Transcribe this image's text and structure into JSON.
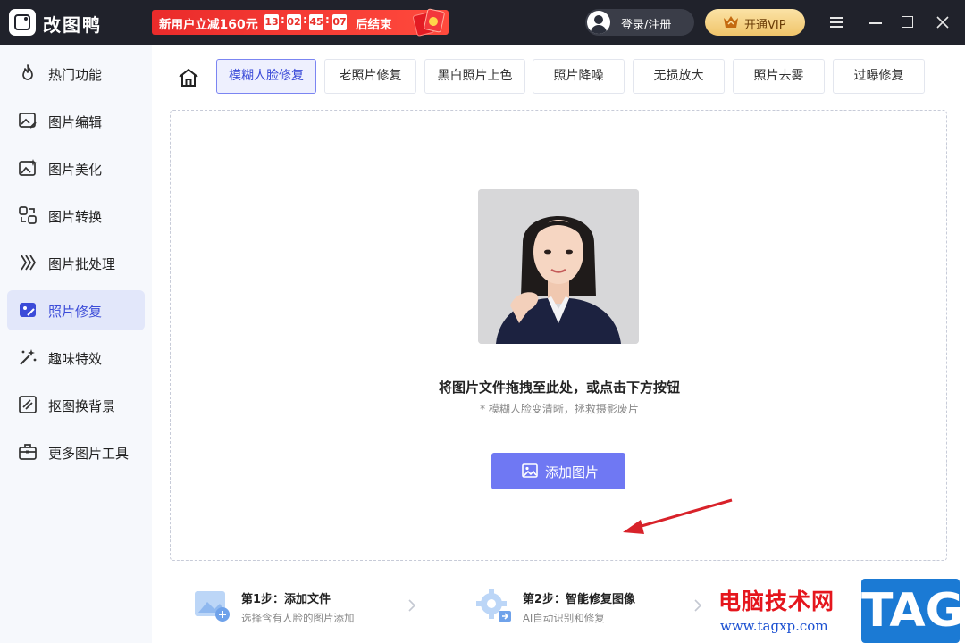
{
  "app": {
    "name": "改图鸭"
  },
  "promo": {
    "text_prefix": "新用户立减",
    "amount": "160元",
    "countdown": [
      "13",
      "02",
      "45",
      "07"
    ],
    "suffix": "后结束"
  },
  "header": {
    "login_label": "登录/注册",
    "vip_label": "开通VIP"
  },
  "sidebar": {
    "items": [
      {
        "label": "热门功能",
        "icon": "fire-icon"
      },
      {
        "label": "图片编辑",
        "icon": "image-edit-icon"
      },
      {
        "label": "图片美化",
        "icon": "image-beautify-icon"
      },
      {
        "label": "图片转换",
        "icon": "image-convert-icon"
      },
      {
        "label": "图片批处理",
        "icon": "batch-process-icon"
      },
      {
        "label": "照片修复",
        "icon": "photo-repair-icon",
        "active": true
      },
      {
        "label": "趣味特效",
        "icon": "magic-wand-icon"
      },
      {
        "label": "抠图换背景",
        "icon": "cutout-icon"
      },
      {
        "label": "更多图片工具",
        "icon": "toolbox-icon"
      }
    ]
  },
  "tabs": [
    {
      "label": "模糊人脸修复",
      "active": true
    },
    {
      "label": "老照片修复"
    },
    {
      "label": "黑白照片上色"
    },
    {
      "label": "照片降噪"
    },
    {
      "label": "无损放大"
    },
    {
      "label": "照片去雾"
    },
    {
      "label": "过曝修复"
    }
  ],
  "dropzone": {
    "title": "将图片文件拖拽至此处，或点击下方按钮",
    "subtitle": "* 模糊人脸变清晰，拯救摄影废片",
    "button_label": "添加图片"
  },
  "steps": [
    {
      "title": "第1步：添加文件",
      "sub": "选择含有人脸的图片添加"
    },
    {
      "title": "第2步：智能修复图像",
      "sub": "AI自动识别和修复"
    }
  ],
  "watermark": {
    "cn": "电脑技术网",
    "url": "www.tagxp.com",
    "tag": "TAG"
  },
  "colors": {
    "accent": "#6f78f3",
    "titlebar": "#20222b",
    "promo": "#ea2b2b",
    "vip": "#f0c46a"
  }
}
